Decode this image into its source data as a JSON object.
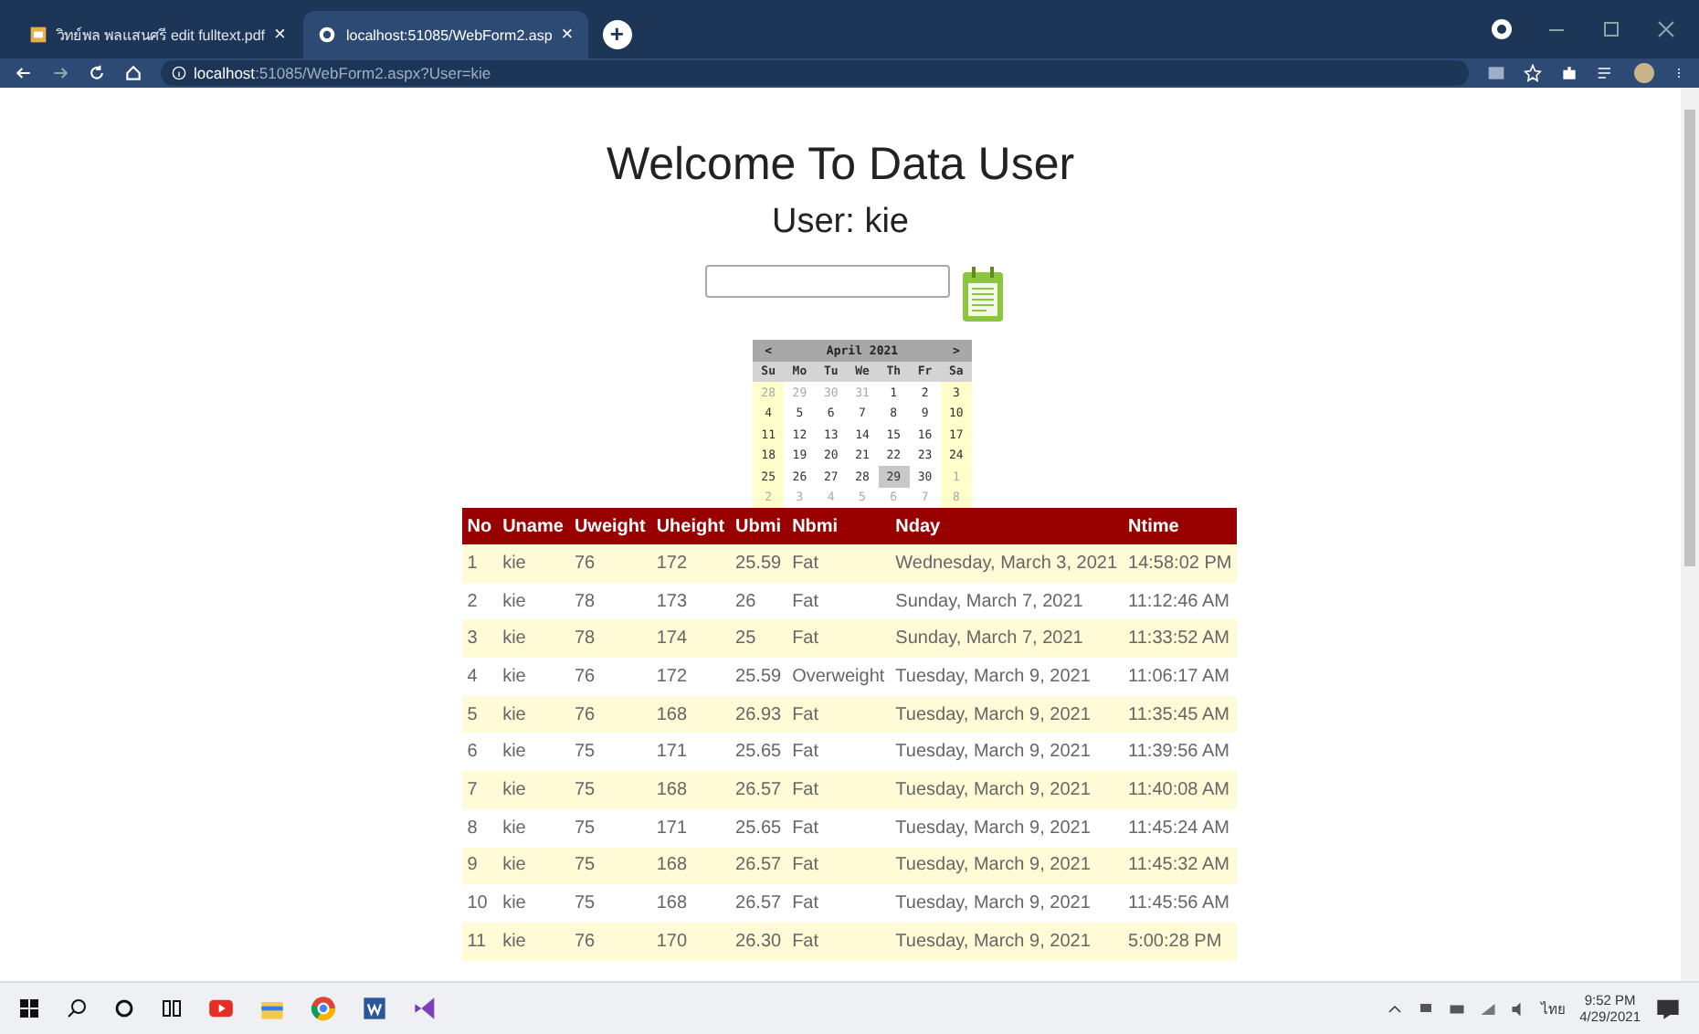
{
  "browser": {
    "tabs": [
      {
        "title": "วิทย์พล พลแสนศรี edit fulltext.pdf",
        "close": "×",
        "selected": false
      },
      {
        "title": "localhost:51085/WebForm2.asp",
        "close": "×",
        "selected": true
      }
    ],
    "new_tab": "+",
    "address": {
      "host": "localhost",
      "path": ":51085/WebForm2.aspx?User=kie"
    }
  },
  "page": {
    "title": "Welcome To Data User",
    "subtitle": "User: kie",
    "calendar": {
      "prev": "<",
      "month": "April 2021",
      "next": ">",
      "weekdays": [
        "Su",
        "Mo",
        "Tu",
        "We",
        "Th",
        "Fr",
        "Sa"
      ],
      "weeks": [
        [
          {
            "text": "28",
            "muted": true,
            "selected": false
          },
          {
            "text": "29",
            "muted": true,
            "selected": false
          },
          {
            "text": "30",
            "muted": true,
            "selected": false
          },
          {
            "text": "31",
            "muted": true,
            "selected": false
          },
          {
            "text": "1",
            "muted": false,
            "selected": false
          },
          {
            "text": "2",
            "muted": false,
            "selected": false
          },
          {
            "text": "3",
            "muted": false,
            "selected": false
          }
        ],
        [
          {
            "text": "4",
            "muted": false,
            "selected": false
          },
          {
            "text": "5",
            "muted": false,
            "selected": false
          },
          {
            "text": "6",
            "muted": false,
            "selected": false
          },
          {
            "text": "7",
            "muted": false,
            "selected": false
          },
          {
            "text": "8",
            "muted": false,
            "selected": false
          },
          {
            "text": "9",
            "muted": false,
            "selected": false
          },
          {
            "text": "10",
            "muted": false,
            "selected": false
          }
        ],
        [
          {
            "text": "11",
            "muted": false,
            "selected": false
          },
          {
            "text": "12",
            "muted": false,
            "selected": false
          },
          {
            "text": "13",
            "muted": false,
            "selected": false
          },
          {
            "text": "14",
            "muted": false,
            "selected": false
          },
          {
            "text": "15",
            "muted": false,
            "selected": false
          },
          {
            "text": "16",
            "muted": false,
            "selected": false
          },
          {
            "text": "17",
            "muted": false,
            "selected": false
          }
        ],
        [
          {
            "text": "18",
            "muted": false,
            "selected": false
          },
          {
            "text": "19",
            "muted": false,
            "selected": false
          },
          {
            "text": "20",
            "muted": false,
            "selected": false
          },
          {
            "text": "21",
            "muted": false,
            "selected": false
          },
          {
            "text": "22",
            "muted": false,
            "selected": false
          },
          {
            "text": "23",
            "muted": false,
            "selected": false
          },
          {
            "text": "24",
            "muted": false,
            "selected": false
          }
        ],
        [
          {
            "text": "25",
            "muted": false,
            "selected": false
          },
          {
            "text": "26",
            "muted": false,
            "selected": false
          },
          {
            "text": "27",
            "muted": false,
            "selected": false
          },
          {
            "text": "28",
            "muted": false,
            "selected": false
          },
          {
            "text": "29",
            "muted": false,
            "selected": true
          },
          {
            "text": "30",
            "muted": false,
            "selected": false
          },
          {
            "text": "1",
            "muted": true,
            "selected": false
          }
        ],
        [
          {
            "text": "2",
            "muted": true,
            "selected": false
          },
          {
            "text": "3",
            "muted": true,
            "selected": false
          },
          {
            "text": "4",
            "muted": true,
            "selected": false
          },
          {
            "text": "5",
            "muted": true,
            "selected": false
          },
          {
            "text": "6",
            "muted": true,
            "selected": false
          },
          {
            "text": "7",
            "muted": true,
            "selected": false
          },
          {
            "text": "8",
            "muted": true,
            "selected": false
          }
        ]
      ]
    },
    "table": {
      "columns": [
        "No",
        "Uname",
        "Uweight",
        "Uheight",
        "Ubmi",
        "Nbmi",
        "Nday",
        "Ntime"
      ],
      "rows": [
        [
          "1",
          "kie",
          "76",
          "172",
          "25.59",
          "Fat",
          "Wednesday, March 3, 2021",
          "14:58:02 PM"
        ],
        [
          "2",
          "kie",
          "78",
          "173",
          "26",
          "Fat",
          "Sunday, March 7, 2021",
          "11:12:46 AM"
        ],
        [
          "3",
          "kie",
          "78",
          "174",
          "25",
          "Fat",
          "Sunday, March 7, 2021",
          "11:33:52 AM"
        ],
        [
          "4",
          "kie",
          "76",
          "172",
          "25.59",
          "Overweight",
          "Tuesday, March 9, 2021",
          "11:06:17 AM"
        ],
        [
          "5",
          "kie",
          "76",
          "168",
          "26.93",
          "Fat",
          "Tuesday, March 9, 2021",
          "11:35:45 AM"
        ],
        [
          "6",
          "kie",
          "75",
          "171",
          "25.65",
          "Fat",
          "Tuesday, March 9, 2021",
          "11:39:56 AM"
        ],
        [
          "7",
          "kie",
          "75",
          "168",
          "26.57",
          "Fat",
          "Tuesday, March 9, 2021",
          "11:40:08 AM"
        ],
        [
          "8",
          "kie",
          "75",
          "171",
          "25.65",
          "Fat",
          "Tuesday, March 9, 2021",
          "11:45:24 AM"
        ],
        [
          "9",
          "kie",
          "75",
          "168",
          "26.57",
          "Fat",
          "Tuesday, March 9, 2021",
          "11:45:32 AM"
        ],
        [
          "10",
          "kie",
          "75",
          "168",
          "26.57",
          "Fat",
          "Tuesday, March 9, 2021",
          "11:45:56 AM"
        ],
        [
          "11",
          "kie",
          "76",
          "170",
          "26.30",
          "Fat",
          "Tuesday, March 9, 2021",
          "5:00:28 PM"
        ]
      ]
    }
  },
  "taskbar": {
    "language": "ไทย",
    "time": "9:52 PM",
    "date": "4/29/2021"
  }
}
